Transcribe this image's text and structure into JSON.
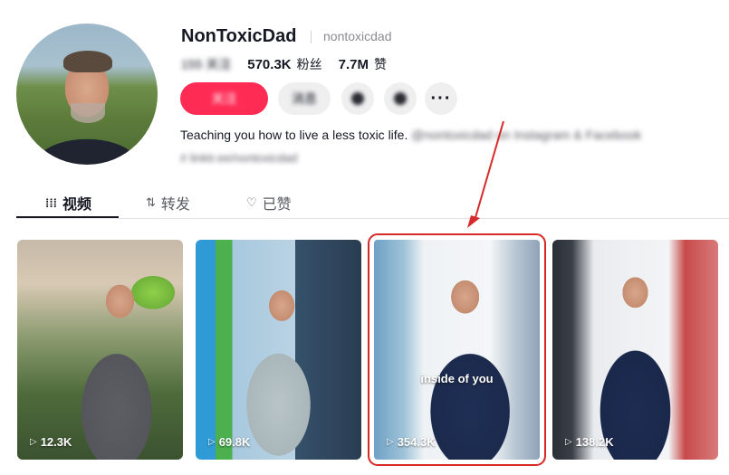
{
  "profile": {
    "display_name": "NonToxicDad",
    "username": "nontoxicdad",
    "following_label": "155 关注",
    "followers_count": "570.3K",
    "followers_label": "粉丝",
    "likes_count": "7.7M",
    "likes_label": "赞",
    "bio_visible": "Teaching you how to live a less toxic life.",
    "bio_blurred": "@nontoxicdad on Instagram & Facebook",
    "bio_line2": "# linktr.ee/nontoxicdad"
  },
  "actions": {
    "follow_label": "关注",
    "message_label": "消息",
    "more_label": "···"
  },
  "tabs": [
    {
      "label": "视频",
      "icon": "grid-icon",
      "active": true
    },
    {
      "label": "转发",
      "icon": "repost-icon",
      "active": false
    },
    {
      "label": "已赞",
      "icon": "heart-icon",
      "active": false
    }
  ],
  "videos": [
    {
      "views": "12.3K",
      "caption": ""
    },
    {
      "views": "69.8K",
      "caption": ""
    },
    {
      "views": "354.3K",
      "caption": "inside of you",
      "highlighted": true
    },
    {
      "views": "138.2K",
      "caption": ""
    }
  ],
  "colors": {
    "accent": "#fe2c55",
    "highlight": "#d62a2a"
  }
}
